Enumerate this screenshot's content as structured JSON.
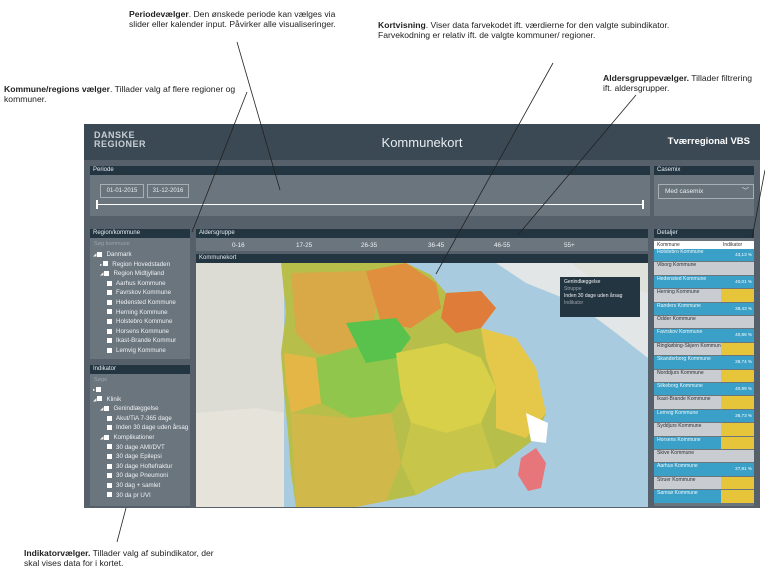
{
  "annotations": {
    "period": {
      "title": "Periodevælger",
      "text": ". Den ønskede periode kan vælges via slider eller kalender input. Påvirker alle visualiseringer."
    },
    "map": {
      "title": "Kortvisning",
      "text": ". Viser data farvekodet ift. værdierne for den valgte subindikator. Farvekodning er relativ ift. de valgte kommuner/ regioner."
    },
    "region": {
      "title": "Kommune/regions vælger",
      "text": ". Tillader valg af flere regioner og kommuner."
    },
    "age": {
      "title": "Aldersgruppevælger.",
      "text": " Tillader filtrering ift. aldersgrupper."
    },
    "indicator": {
      "title": "Indikatorvælger.",
      "text": " Tillader valg af subindikator, der skal vises data for i kortet."
    }
  },
  "header": {
    "logo_line1": "DANSKE",
    "logo_line2": "REGIONER",
    "title": "Kommunekort",
    "right": "Tværregional VBS"
  },
  "periode": {
    "label": "Periode",
    "from": "01-01-2015",
    "to": "31-12-2016",
    "slider_start": 0,
    "slider_end": 1
  },
  "casemix": {
    "label": "Casemix",
    "value": "Med casemix"
  },
  "region_panel": {
    "label": "Region/kommune",
    "search": "Søg kommune",
    "items": [
      {
        "label": "Danmark",
        "indent": 0,
        "prefix": "◢"
      },
      {
        "label": "Region Hovedstaden",
        "indent": 1,
        "prefix": "▸"
      },
      {
        "label": "Region Midtjylland",
        "indent": 1,
        "prefix": "◢"
      },
      {
        "label": "Aarhus Kommune",
        "indent": 2,
        "prefix": ""
      },
      {
        "label": "Favrskov Kommune",
        "indent": 2,
        "prefix": ""
      },
      {
        "label": "Hedensted Kommune",
        "indent": 2,
        "prefix": ""
      },
      {
        "label": "Herning Kommune",
        "indent": 2,
        "prefix": ""
      },
      {
        "label": "Holstebro Kommune",
        "indent": 2,
        "prefix": ""
      },
      {
        "label": "Horsens Kommune",
        "indent": 2,
        "prefix": ""
      },
      {
        "label": "Ikast-Brande Kommur",
        "indent": 2,
        "prefix": ""
      },
      {
        "label": "Lemvig Kommune",
        "indent": 2,
        "prefix": ""
      }
    ]
  },
  "indikator_panel": {
    "label": "Indikator",
    "search": "Søge",
    "items": [
      {
        "label": "",
        "indent": 0,
        "prefix": "▸"
      },
      {
        "label": "Klinik",
        "indent": 0,
        "prefix": "◢"
      },
      {
        "label": "Genindlæggelse",
        "indent": 1,
        "prefix": "◢"
      },
      {
        "label": "Akut/TiA 7-365 dage",
        "indent": 2,
        "prefix": ""
      },
      {
        "label": "Inden 30 dage uden årsag",
        "indent": 2,
        "prefix": ""
      },
      {
        "label": "Komplikationer",
        "indent": 1,
        "prefix": "◢"
      },
      {
        "label": "30 dage AMI/DVT",
        "indent": 2,
        "prefix": ""
      },
      {
        "label": "30 dage Epilepsi",
        "indent": 2,
        "prefix": ""
      },
      {
        "label": "30 dage Hoftefraktur",
        "indent": 2,
        "prefix": ""
      },
      {
        "label": "30 dage Pneumoni",
        "indent": 2,
        "prefix": ""
      },
      {
        "label": "30 dag + samlet",
        "indent": 2,
        "prefix": ""
      },
      {
        "label": "30 da pr UVI",
        "indent": 2,
        "prefix": ""
      }
    ]
  },
  "age_panel": {
    "label": "Aldersgruppe",
    "groups": [
      "0-16",
      "17-25",
      "26-35",
      "36-45",
      "46-55",
      "55+"
    ]
  },
  "map_panel": {
    "label": "Kommunekort",
    "legend": {
      "title": "Genindlæggelse",
      "subtitle": "Struppe",
      "line": "Inden 30 dage uden årsag",
      "footer": "Indikator"
    }
  },
  "details": {
    "label": "Detaljer",
    "col_name": "Kommune",
    "col_value": "Indikator",
    "rows": [
      {
        "name": "Holstebro Kommune",
        "value": "43,13 %",
        "bg": "#3aa0c8",
        "vbg": "#3aa0c8"
      },
      {
        "name": "Viborg Kommune",
        "value": "",
        "bg": "#c9cdd1",
        "vbg": "#c9cdd1"
      },
      {
        "name": "Hedensted Kommune",
        "value": "40,01 %",
        "bg": "#3aa0c8",
        "vbg": "#3aa0c8"
      },
      {
        "name": "Herning Kommune",
        "value": "",
        "bg": "#c9cdd1",
        "vbg": "#e7c53a"
      },
      {
        "name": "Randers Kommune",
        "value": "39,43 %",
        "bg": "#3aa0c8",
        "vbg": "#3aa0c8"
      },
      {
        "name": "Odder Kommune",
        "value": "",
        "bg": "#c9cdd1",
        "vbg": "#c9cdd1"
      },
      {
        "name": "Favrskov Kommune",
        "value": "40,86 %",
        "bg": "#3aa0c8",
        "vbg": "#3aa0c8"
      },
      {
        "name": "Ringkøbing-Skjern Kommune",
        "value": "",
        "bg": "#c9cdd1",
        "vbg": "#e7c53a"
      },
      {
        "name": "Skanderborg Kommune",
        "value": "39,74 %",
        "bg": "#3aa0c8",
        "vbg": "#3aa0c8"
      },
      {
        "name": "Norddjurs Kommune",
        "value": "",
        "bg": "#c9cdd1",
        "vbg": "#e7c53a"
      },
      {
        "name": "Silkeborg Kommune",
        "value": "40,99 %",
        "bg": "#3aa0c8",
        "vbg": "#3aa0c8"
      },
      {
        "name": "Ikast-Brande Kommune",
        "value": "",
        "bg": "#c9cdd1",
        "vbg": "#e7c53a"
      },
      {
        "name": "Lemvig Kommune",
        "value": "38,73 %",
        "bg": "#3aa0c8",
        "vbg": "#3aa0c8"
      },
      {
        "name": "Syddjurs Kommune",
        "value": "",
        "bg": "#c9cdd1",
        "vbg": "#e7c53a"
      },
      {
        "name": "Horsens Kommune",
        "value": "",
        "bg": "#3aa0c8",
        "vbg": "#e7c53a"
      },
      {
        "name": "Skive Kommune",
        "value": "",
        "bg": "#c9cdd1",
        "vbg": "#c9cdd1"
      },
      {
        "name": "Aarhus Kommune",
        "value": "37,81 %",
        "bg": "#3aa0c8",
        "vbg": "#3aa0c8"
      },
      {
        "name": "Struer Kommune",
        "value": "",
        "bg": "#c9cdd1",
        "vbg": "#e7c53a"
      },
      {
        "name": "Samsø Kommune",
        "value": "",
        "bg": "#3aa0c8",
        "vbg": "#e7c53a"
      }
    ]
  },
  "colors": {
    "header": "#3b4954",
    "panel_header": "#243542",
    "panel": "#6b757e",
    "accent_blue": "#3aa0c8",
    "accent_yellow": "#e7c53a"
  }
}
